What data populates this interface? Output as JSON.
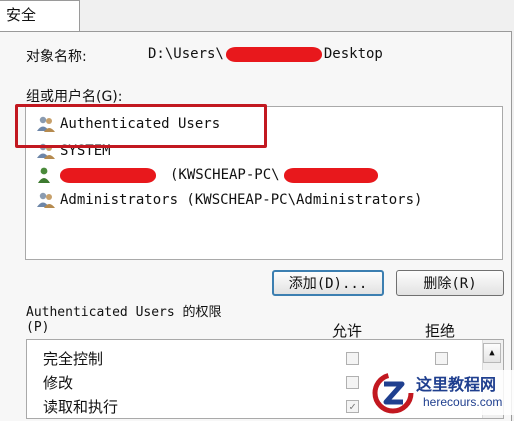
{
  "tab": {
    "label": "安全"
  },
  "object": {
    "label": "对象名称:",
    "path_prefix": "D:\\Users\\",
    "path_suffix": "Desktop"
  },
  "groups": {
    "label": "组或用户名(G):",
    "items": [
      {
        "name": "Authenticated Users"
      },
      {
        "name": "SYSTEM"
      },
      {
        "name": "(KWSCHEAP-PC\\"
      },
      {
        "name": "Administrators (KWSCHEAP-PC\\Administrators)"
      }
    ]
  },
  "buttons": {
    "add": "添加(D)...",
    "remove": "删除(R)"
  },
  "permissions": {
    "title": "Authenticated Users 的权限",
    "access_key": "(P)",
    "col_allow": "允许",
    "col_deny": "拒绝",
    "rows": [
      {
        "label": "完全控制",
        "allow": false,
        "deny": false
      },
      {
        "label": "修改",
        "allow": false,
        "deny": false
      },
      {
        "label": "读取和执行",
        "allow": true,
        "deny": false
      }
    ]
  },
  "watermark": {
    "brand": "这里教程网",
    "url": "herecours.com"
  },
  "colors": {
    "highlight": "#c21820",
    "redaction": "#e8181c",
    "focus_border": "#3c7fb1"
  },
  "icons": {
    "user_group": "users-icon",
    "user": "user-icon"
  }
}
